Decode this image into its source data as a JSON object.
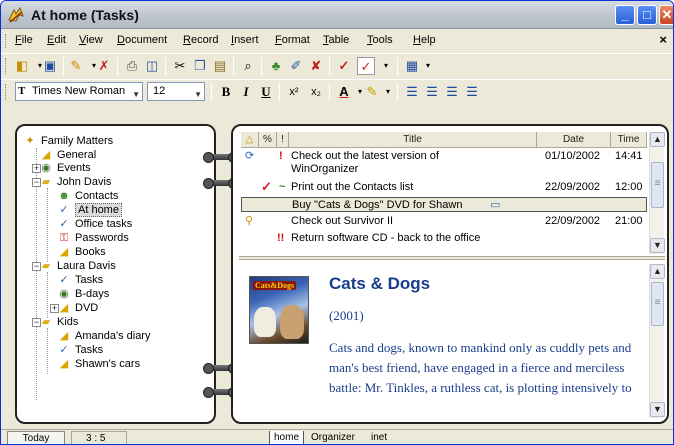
{
  "window": {
    "title": "At home (Tasks)",
    "controls": {
      "minimize": "_",
      "maximize": "□",
      "close": "✕"
    }
  },
  "menubar": {
    "items": [
      "File",
      "Edit",
      "View",
      "Document",
      "Record",
      "Insert",
      "Format",
      "Table",
      "Tools",
      "Help"
    ],
    "close_glyph": "×"
  },
  "toolbar_main": {
    "icons": [
      "new-icon",
      "save-icon",
      "tasks-icon",
      "delete-icon",
      "print-icon",
      "print-preview-icon",
      "cut-icon",
      "copy-icon",
      "paste-icon",
      "find-icon",
      "contacts-icon",
      "edit-icon",
      "remove-icon",
      "check-icon",
      "checkbox-icon",
      "table-icon"
    ]
  },
  "toolbar_format": {
    "font": "Times New Roman",
    "size": "12",
    "bold": "B",
    "italic": "I",
    "underline": "U",
    "superscript": "x²",
    "subscript": "x₂",
    "font_color": "A",
    "highlight": "✎"
  },
  "tree": {
    "root": "Family Matters",
    "items": [
      {
        "label": "General",
        "level": 1
      },
      {
        "label": "Events",
        "level": 1,
        "expander": "+"
      },
      {
        "label": "John Davis",
        "level": 1,
        "expander": "−"
      },
      {
        "label": "Contacts",
        "level": 2
      },
      {
        "label": "At home",
        "level": 2,
        "selected": true
      },
      {
        "label": "Office tasks",
        "level": 2
      },
      {
        "label": "Passwords",
        "level": 2
      },
      {
        "label": "Books",
        "level": 2
      },
      {
        "label": "Laura Davis",
        "level": 1,
        "expander": "−"
      },
      {
        "label": "Tasks",
        "level": 2
      },
      {
        "label": "B-days",
        "level": 2
      },
      {
        "label": "DVD",
        "level": 2,
        "expander": "+"
      },
      {
        "label": "Kids",
        "level": 1,
        "expander": "−"
      },
      {
        "label": "Amanda's diary",
        "level": 2
      },
      {
        "label": "Tasks",
        "level": 2
      },
      {
        "label": "Shawn's cars",
        "level": 2
      }
    ]
  },
  "grid": {
    "columns": {
      "flag": "△",
      "percent": "%",
      "priority": "!",
      "title": "Title",
      "date": "Date",
      "time": "Time"
    },
    "rows": [
      {
        "flag": "⟳",
        "check": "",
        "priority": "!",
        "title": "Check out the latest version of",
        "title2": "WinOrganizer",
        "date": "01/10/2002",
        "time": "14:41"
      },
      {
        "flag": "",
        "check": "✓",
        "priority": "~",
        "title": "Print out the Contacts list",
        "title2": "",
        "date": "22/09/2002",
        "time": "12:00"
      },
      {
        "flag": "",
        "check": "",
        "priority": "",
        "title": "Buy \"Cats & Dogs\" DVD for Shawn",
        "title2": "",
        "date": "",
        "time": ""
      },
      {
        "flag": "⚲",
        "check": "",
        "priority": "",
        "title": "Check out Survivor II",
        "title2": "",
        "date": "22/09/2002",
        "time": "21:00"
      },
      {
        "flag": "",
        "check": "",
        "priority": "!!",
        "title": "Return software CD - back to the office",
        "title2": "",
        "date": "",
        "time": ""
      }
    ]
  },
  "preview": {
    "cover_logo": "Cats&Dogs",
    "title": "Cats & Dogs",
    "year": "(2001)",
    "description": "Cats and dogs, known to mankind only as cuddly pets and man's best friend, have engaged in a fierce and merciless battle: Mr. Tinkles, a ruthless cat, is plotting intensively to"
  },
  "statusbar": {
    "today": "Today",
    "count": "3 : 5",
    "tabs": [
      "home",
      "Organizer",
      "inet"
    ]
  },
  "colors": {
    "accent_blue": "#1a3d8a",
    "checkmark_red": "#d42020",
    "priority_red": "#cc1010"
  }
}
